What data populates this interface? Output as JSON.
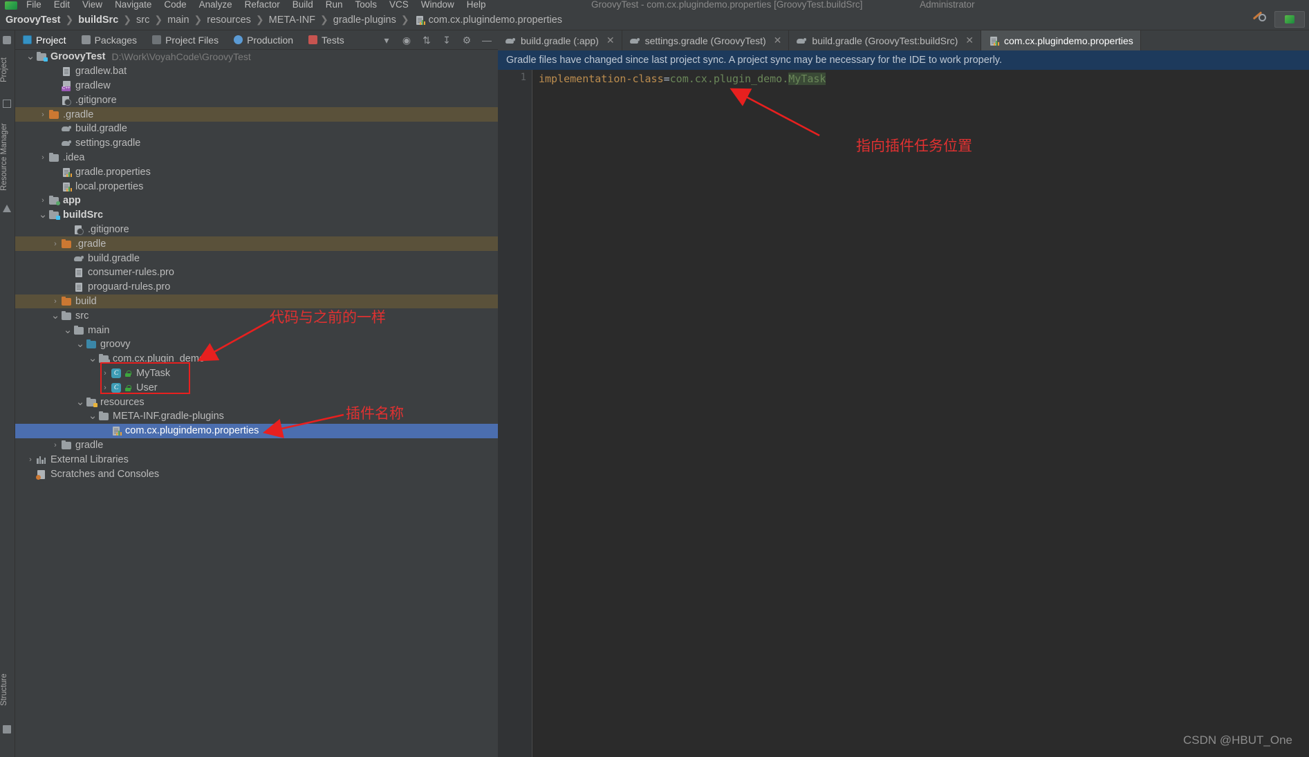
{
  "window": {
    "title": "GroovyTest - com.cx.plugindemo.properties [GroovyTest.buildSrc]",
    "admin": "Administrator"
  },
  "menubar": {
    "items": [
      "File",
      "Edit",
      "View",
      "Navigate",
      "Code",
      "Analyze",
      "Refactor",
      "Build",
      "Run",
      "Tools",
      "VCS",
      "Window",
      "Help"
    ]
  },
  "breadcrumb": {
    "items": [
      "GroovyTest",
      "buildSrc",
      "src",
      "main",
      "resources",
      "META-INF",
      "gradle-plugins",
      "com.cx.plugindemo.properties"
    ]
  },
  "left_strip": {
    "project_label": "Project",
    "resource_manager_label": "Resource Manager",
    "structure_label": "Structure"
  },
  "tool_window": {
    "tabs": [
      {
        "label": "Project",
        "icon": "project-icon",
        "active": true
      },
      {
        "label": "Packages",
        "icon": "packages-icon",
        "active": false
      },
      {
        "label": "Project Files",
        "icon": "project-files-icon",
        "active": false
      },
      {
        "label": "Production",
        "icon": "production-icon",
        "active": false
      },
      {
        "label": "Tests",
        "icon": "tests-icon",
        "active": false
      }
    ],
    "actions": [
      "chevron-down-icon",
      "locate-icon",
      "expand-all-icon",
      "collapse-all-icon",
      "settings-gear-icon",
      "hide-icon"
    ]
  },
  "tree": [
    {
      "indent": 0,
      "chev": "v",
      "icon": "module-folder",
      "label": "GroovyTest",
      "bold": true,
      "path": "D:\\Work\\VoyahCode\\GroovyTest",
      "state": "normal"
    },
    {
      "indent": 2,
      "chev": "",
      "icon": "file",
      "label": "gradlew.bat",
      "state": "normal"
    },
    {
      "indent": 2,
      "chev": "",
      "icon": "cpp-file",
      "label": "gradlew",
      "state": "normal"
    },
    {
      "indent": 2,
      "chev": "",
      "icon": "gitignore-file",
      "label": ".gitignore",
      "state": "normal"
    },
    {
      "indent": 1,
      "chev": ">",
      "icon": "orange-folder",
      "label": ".gradle",
      "state": "highlighted"
    },
    {
      "indent": 2,
      "chev": "",
      "icon": "gradle-file",
      "label": "build.gradle",
      "state": "normal"
    },
    {
      "indent": 2,
      "chev": "",
      "icon": "gradle-file",
      "label": "settings.gradle",
      "state": "normal"
    },
    {
      "indent": 1,
      "chev": ">",
      "icon": "folder",
      "label": ".idea",
      "state": "normal"
    },
    {
      "indent": 2,
      "chev": "",
      "icon": "properties-file",
      "label": "gradle.properties",
      "state": "normal"
    },
    {
      "indent": 2,
      "chev": "",
      "icon": "properties-file",
      "label": "local.properties",
      "state": "normal"
    },
    {
      "indent": 1,
      "chev": ">",
      "icon": "module-folder-green",
      "label": "app",
      "bold": true,
      "state": "normal"
    },
    {
      "indent": 1,
      "chev": "v",
      "icon": "module-folder",
      "label": "buildSrc",
      "bold": true,
      "state": "normal"
    },
    {
      "indent": 3,
      "chev": "",
      "icon": "gitignore-file",
      "label": ".gitignore",
      "state": "normal"
    },
    {
      "indent": 2,
      "chev": ">",
      "icon": "orange-folder",
      "label": ".gradle",
      "state": "highlighted"
    },
    {
      "indent": 3,
      "chev": "",
      "icon": "gradle-file",
      "label": "build.gradle",
      "state": "normal"
    },
    {
      "indent": 3,
      "chev": "",
      "icon": "file",
      "label": "consumer-rules.pro",
      "state": "normal"
    },
    {
      "indent": 3,
      "chev": "",
      "icon": "file",
      "label": "proguard-rules.pro",
      "state": "normal"
    },
    {
      "indent": 2,
      "chev": ">",
      "icon": "orange-folder",
      "label": "build",
      "state": "highlighted"
    },
    {
      "indent": 2,
      "chev": "v",
      "icon": "folder",
      "label": "src",
      "state": "normal"
    },
    {
      "indent": 3,
      "chev": "v",
      "icon": "folder",
      "label": "main",
      "state": "normal"
    },
    {
      "indent": 4,
      "chev": "v",
      "icon": "source-folder",
      "label": "groovy",
      "state": "normal"
    },
    {
      "indent": 5,
      "chev": "v",
      "icon": "package-folder",
      "label": "com.cx.plugin_demo",
      "state": "normal"
    },
    {
      "indent": 6,
      "chev": ">",
      "icon": "groovy-class",
      "label": "MyTask",
      "state": "normal"
    },
    {
      "indent": 6,
      "chev": ">",
      "icon": "groovy-class",
      "label": "User",
      "state": "normal"
    },
    {
      "indent": 4,
      "chev": "v",
      "icon": "resource-folder",
      "label": "resources",
      "state": "normal"
    },
    {
      "indent": 5,
      "chev": "v",
      "icon": "folder",
      "label": "META-INF.gradle-plugins",
      "state": "normal"
    },
    {
      "indent": 6,
      "chev": "",
      "icon": "properties-file",
      "label": "com.cx.plugindemo.properties",
      "state": "selected"
    },
    {
      "indent": 2,
      "chev": ">",
      "icon": "folder",
      "label": "gradle",
      "state": "normal"
    },
    {
      "indent": 0,
      "chev": ">",
      "icon": "libraries",
      "label": "External Libraries",
      "state": "normal"
    },
    {
      "indent": 0,
      "chev": "",
      "icon": "scratches",
      "label": "Scratches and Consoles",
      "state": "normal"
    }
  ],
  "editor": {
    "tabs": [
      {
        "label": "build.gradle (:app)",
        "icon": "gradle-icon",
        "active": false,
        "closable": true
      },
      {
        "label": "settings.gradle (GroovyTest)",
        "icon": "gradle-icon",
        "active": false,
        "closable": true
      },
      {
        "label": "build.gradle (GroovyTest:buildSrc)",
        "icon": "gradle-icon",
        "active": false,
        "closable": true
      },
      {
        "label": "com.cx.plugindemo.properties",
        "icon": "properties-icon",
        "active": true,
        "closable": false
      }
    ],
    "banner": "Gradle files have changed since last project sync. A project sync may be necessary for the IDE to work properly.",
    "line_number": "1",
    "code": {
      "key": "implementation-class",
      "equals": "=",
      "value_prefix": "com.cx.plugin_demo.",
      "value_highlight": "MyTask"
    }
  },
  "annotations": [
    {
      "name": "pointer-to-plugin-task-location",
      "text": "指向插件任务位置"
    },
    {
      "name": "code-same-as-before",
      "text": "代码与之前的一样"
    },
    {
      "name": "plugin-name",
      "text": "插件名称"
    }
  ],
  "watermark": "CSDN @HBUT_One",
  "colors": {
    "accent_blue": "#4b6eaf",
    "banner_blue": "#1d3a5c",
    "annotation_red": "#e8201f",
    "highlight_row": "#5a513a",
    "editor_bg": "#2b2b2b",
    "panel_bg": "#3c3f41"
  }
}
